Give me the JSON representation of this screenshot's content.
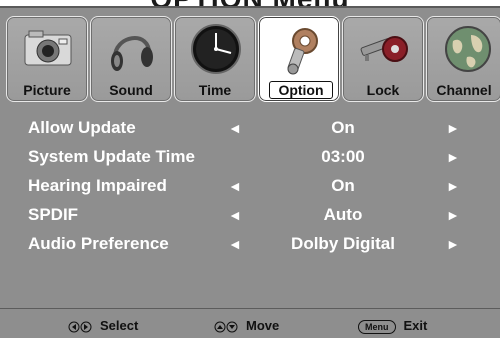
{
  "title": "OPTION Menu",
  "tabs": [
    {
      "label": "Picture",
      "icon": "camera-icon"
    },
    {
      "label": "Sound",
      "icon": "headphones-icon"
    },
    {
      "label": "Time",
      "icon": "clock-icon"
    },
    {
      "label": "Option",
      "icon": "gears-icon"
    },
    {
      "label": "Lock",
      "icon": "key-lock-icon"
    },
    {
      "label": "Channel",
      "icon": "globe-icon"
    }
  ],
  "active_tab": "Option",
  "rows": [
    {
      "label": "Allow Update",
      "value": "On",
      "has_left_arrow": true
    },
    {
      "label": "System Update Time",
      "value": "03:00",
      "has_left_arrow": false
    },
    {
      "label": "Hearing Impaired",
      "value": "On",
      "has_left_arrow": true
    },
    {
      "label": "SPDIF",
      "value": "Auto",
      "has_left_arrow": true
    },
    {
      "label": "Audio Preference",
      "value": "Dolby Digital",
      "has_left_arrow": true
    }
  ],
  "arrows": {
    "left": "◄",
    "right": "►"
  },
  "footer": {
    "select_label": "Select",
    "move_label": "Move",
    "menu_key": "Menu",
    "exit_label": "Exit"
  }
}
